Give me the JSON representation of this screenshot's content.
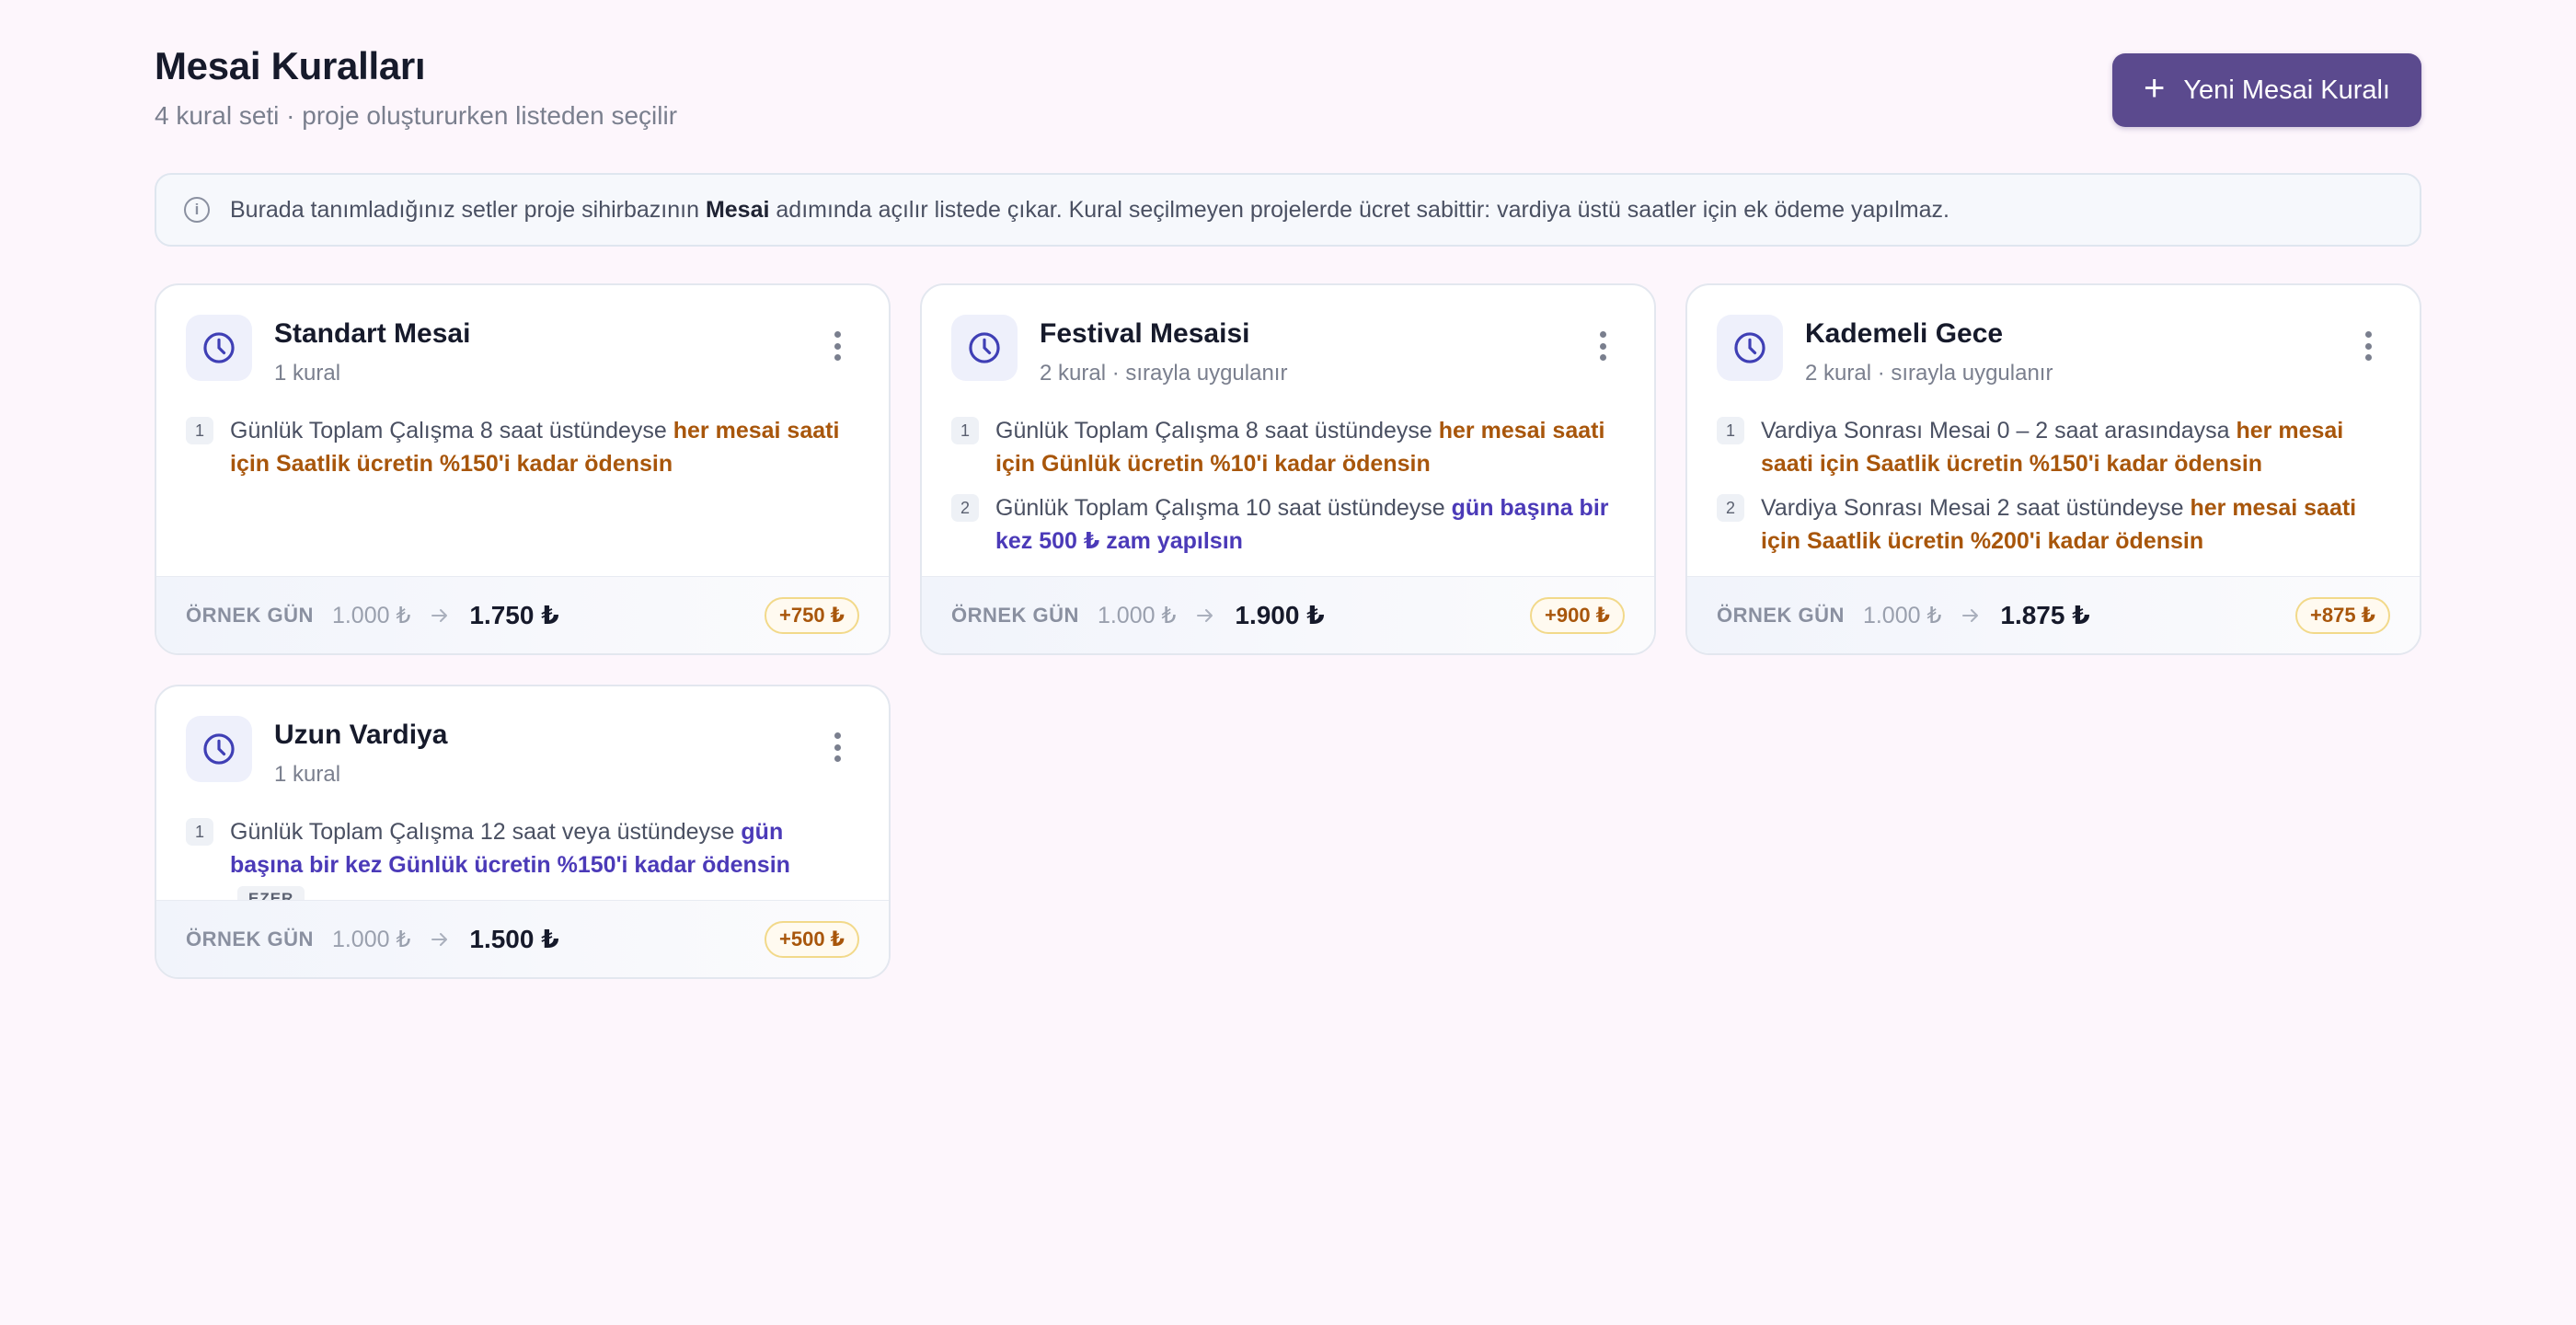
{
  "header": {
    "title": "Mesai Kuralları",
    "subtitle": "4 kural seti · proje oluştururken listeden seçilir",
    "new_button_label": "Yeni Mesai Kuralı"
  },
  "info": {
    "text_before": "Burada tanımladığınız setler proje sihirbazının ",
    "text_bold": "Mesai",
    "text_after": " adımında açılır listede çıkar. Kural seçilmeyen projelerde ücret sabittir: vardiya üstü saatler için ek ödeme yapılmaz."
  },
  "footer_label": "ÖRNEK GÜN",
  "cards": [
    {
      "title": "Standart Mesai",
      "meta": "1 kural",
      "rules": [
        {
          "num": "1",
          "prefix": "Günlük Toplam Çalışma 8 saat üstündeyse ",
          "highlight": "her mesai saati için Saatlik ücretin %150'i kadar ödensin",
          "tag": ""
        }
      ],
      "base": "1.000 ₺",
      "total": "1.750 ₺",
      "diff": "+750 ₺"
    },
    {
      "title": "Festival Mesaisi",
      "meta": "2 kural · sırayla uygulanır",
      "rules": [
        {
          "num": "1",
          "prefix": "Günlük Toplam Çalışma 8 saat üstündeyse ",
          "highlight": "her mesai saati için Günlük ücretin %10'i kadar ödensin",
          "tag": ""
        },
        {
          "num": "2",
          "prefix": "Günlük Toplam Çalışma 10 saat üstündeyse ",
          "highlight": "gün başına bir kez 500 ₺ zam yapılsın",
          "tag": ""
        }
      ],
      "base": "1.000 ₺",
      "total": "1.900 ₺",
      "diff": "+900 ₺"
    },
    {
      "title": "Kademeli Gece",
      "meta": "2 kural · sırayla uygulanır",
      "rules": [
        {
          "num": "1",
          "prefix": "Vardiya Sonrası Mesai 0 – 2 saat arasındaysa ",
          "highlight": "her mesai saati için Saatlik ücretin %150'i kadar ödensin",
          "tag": ""
        },
        {
          "num": "2",
          "prefix": "Vardiya Sonrası Mesai 2 saat üstündeyse ",
          "highlight": "her mesai saati için Saatlik ücretin %200'i kadar ödensin",
          "tag": ""
        }
      ],
      "base": "1.000 ₺",
      "total": "1.875 ₺",
      "diff": "+875 ₺"
    },
    {
      "title": "Uzun Vardiya",
      "meta": "1 kural",
      "rules": [
        {
          "num": "1",
          "prefix": "Günlük Toplam Çalışma 12 saat veya üstündeyse ",
          "highlight": "gün başına bir kez Günlük ücretin %150'i kadar ödensin",
          "tag": "EZER"
        }
      ],
      "base": "1.000 ₺",
      "total": "1.500 ₺",
      "diff": "+500 ₺"
    }
  ],
  "colors": {
    "accent": "#5b4a8e",
    "amber_highlight": "#a8560b",
    "violet_highlight": "#4b3ab8",
    "clock_icon": "#3f3fb5"
  },
  "icons": {
    "new_button": "plus-icon",
    "info": "info-icon",
    "card": "clock-icon",
    "menu": "more-vertical-icon",
    "footer": "arrow-right-icon"
  }
}
